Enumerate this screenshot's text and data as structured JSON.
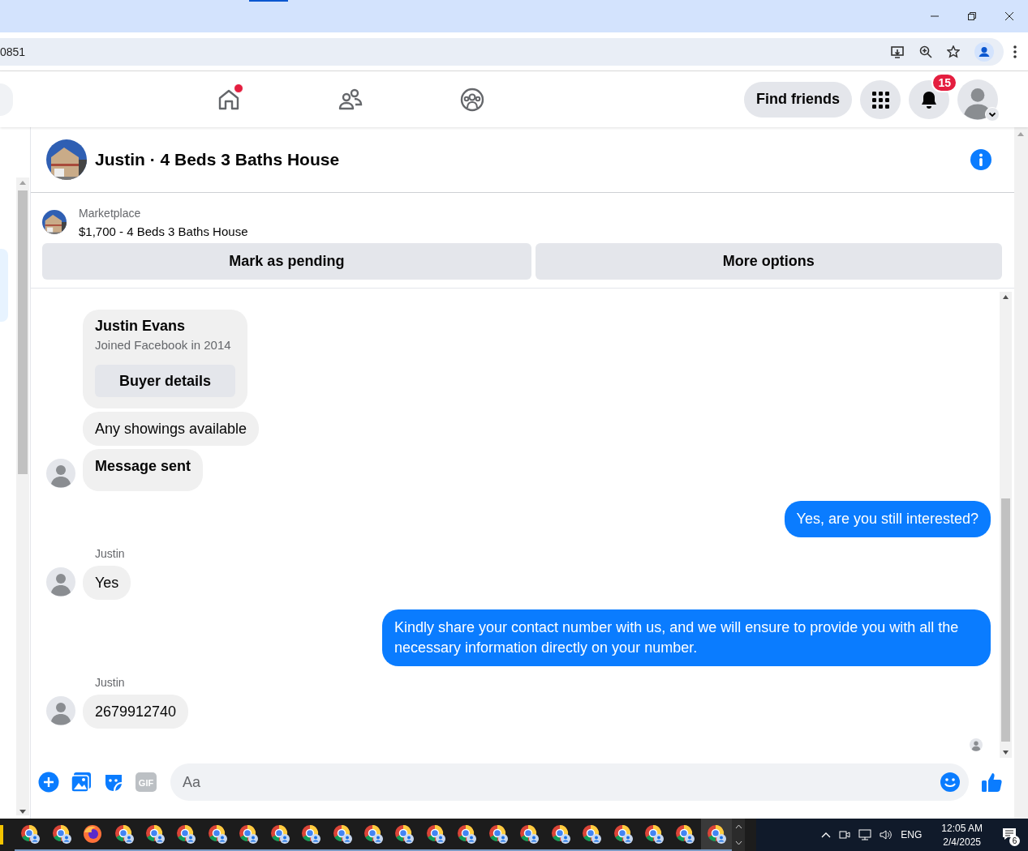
{
  "browser": {
    "url": "0851"
  },
  "nav": {
    "tabs": [
      {
        "kind": "home",
        "dot": true
      },
      {
        "kind": "friends",
        "dot": false
      },
      {
        "kind": "groups",
        "dot": false
      }
    ],
    "find_friends": "Find friends",
    "notification_count": "15"
  },
  "chat": {
    "title": "Justin · 4 Beds 3 Baths House",
    "listing_source": "Marketplace",
    "listing": "$1,700 - 4 Beds 3 Baths House",
    "actions": [
      "Mark as pending",
      "More options"
    ],
    "messages": [
      {
        "kind": "incoming",
        "bubbles": [
          {
            "kind": "card",
            "title": "Justin Evans",
            "subtitle": "Joined Facebook in 2014",
            "button": "Buyer details"
          },
          {
            "kind": "text",
            "text": "Any showings available"
          },
          {
            "kind": "notice",
            "text": "Message sent"
          }
        ]
      },
      {
        "kind": "outgoing",
        "text": "Yes, are you still interested?"
      },
      {
        "kind": "incoming",
        "sender": "Justin",
        "bubbles": [
          {
            "kind": "text",
            "text": "Yes"
          }
        ]
      },
      {
        "kind": "outgoing",
        "text": "Kindly share your contact number with us, and we will ensure to provide you with all the necessary information directly on your number."
      },
      {
        "kind": "incoming",
        "sender": "Justin",
        "bubbles": [
          {
            "kind": "text",
            "text": "2679912740"
          }
        ]
      }
    ],
    "composer": {
      "gif_label": "GIF",
      "placeholder": "Aa"
    }
  },
  "taskbar": {
    "apps": [
      {
        "kind": "chrome",
        "active": false
      },
      {
        "kind": "chrome",
        "active": false
      },
      {
        "kind": "firefox",
        "active": false
      },
      {
        "kind": "chrome",
        "active": false
      },
      {
        "kind": "chrome",
        "active": false
      },
      {
        "kind": "chrome",
        "active": false
      },
      {
        "kind": "chrome",
        "active": false
      },
      {
        "kind": "chrome",
        "active": false
      },
      {
        "kind": "chrome",
        "active": false
      },
      {
        "kind": "chrome",
        "active": false
      },
      {
        "kind": "chrome",
        "active": false
      },
      {
        "kind": "chrome",
        "active": false
      },
      {
        "kind": "chrome",
        "active": false
      },
      {
        "kind": "chrome",
        "active": false
      },
      {
        "kind": "chrome",
        "active": false
      },
      {
        "kind": "chrome",
        "active": false
      },
      {
        "kind": "chrome",
        "active": false
      },
      {
        "kind": "chrome",
        "active": false
      },
      {
        "kind": "chrome",
        "active": false
      },
      {
        "kind": "chrome",
        "active": false
      },
      {
        "kind": "chrome",
        "active": false
      },
      {
        "kind": "chrome",
        "active": false
      },
      {
        "kind": "chrome",
        "active": true
      }
    ],
    "language": "ENG",
    "time": "12:05 AM",
    "date": "2/4/2025",
    "notifications": "6"
  }
}
